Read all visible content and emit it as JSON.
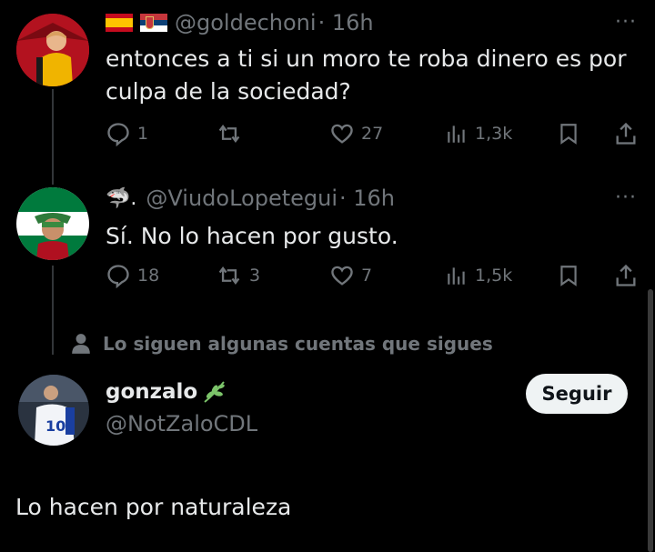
{
  "tweet1": {
    "handle": "@goldechoni",
    "time": "· 16h",
    "text_line1": "entonces a ti si un moro te roba dinero es por",
    "text_line2": "culpa de la sociedad?",
    "replies": "1",
    "retweets": "",
    "likes": "27",
    "views": "1,3k",
    "more": "···"
  },
  "tweet2": {
    "name_emoji": "🦈.",
    "handle": "@ViudoLopetegui",
    "time": "· 16h",
    "text": "Sí. No lo hacen por gusto.",
    "replies": "18",
    "retweets": "3",
    "likes": "7",
    "views": "1,5k",
    "more": "···"
  },
  "social_context": "Lo siguen algunas cuentas que sigues",
  "profile": {
    "name": "gonzalo",
    "handle": "@NotZaloCDL",
    "follow_label": "Seguir",
    "bio": "Lo hacen por naturaleza"
  },
  "colors": {
    "background": "#000000",
    "text": "#e7e9ea",
    "muted": "#71767b",
    "button_bg": "#eff3f4"
  }
}
